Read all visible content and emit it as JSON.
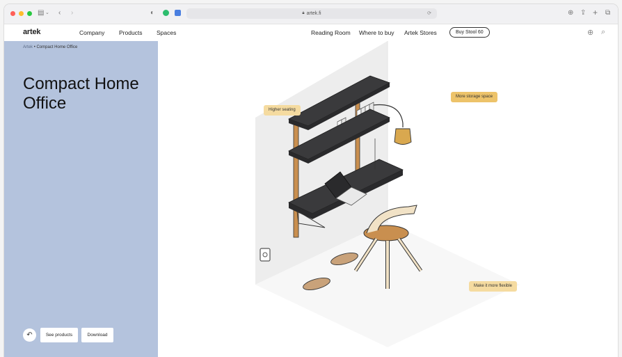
{
  "browser": {
    "url": "artek.fi"
  },
  "nav": {
    "logo": "artek",
    "items": [
      "Company",
      "Products",
      "Spaces",
      "Reading Room",
      "Where to buy",
      "Artek Stores"
    ],
    "buy_button": "Buy Stool 60"
  },
  "breadcrumb": {
    "parent": "Artek",
    "separator": "•",
    "current": "Compact Home Office"
  },
  "page": {
    "title": "Compact Home Office"
  },
  "actions": {
    "see_products": "See products",
    "download": "Download"
  },
  "hotspots": [
    {
      "label": "Higher seating",
      "active": false
    },
    {
      "label": "More storage space",
      "active": true
    },
    {
      "label": "Make it more flexible",
      "active": false
    }
  ],
  "colors": {
    "side_panel": "#b4c3dd",
    "hotspot": "#f5dba0",
    "hotspot_active": "#edc36a",
    "shelf": "#3a3a3c",
    "wood": "#c98f4f"
  }
}
